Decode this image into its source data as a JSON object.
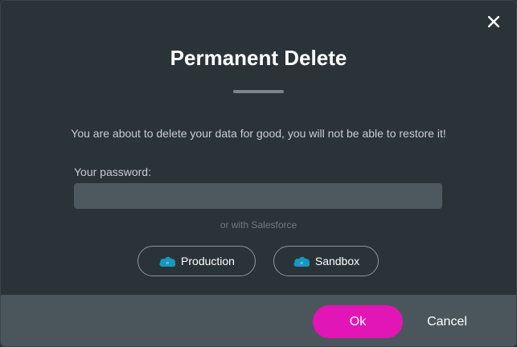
{
  "dialog": {
    "title": "Permanent Delete",
    "warning": "You are about to delete your data for good, you will not be able to restore it!",
    "password_label": "Your password:",
    "password_value": "",
    "password_placeholder": "",
    "or_text": "or with Salesforce",
    "salesforce_buttons": [
      {
        "label": "Production",
        "icon": "salesforce-cloud-icon"
      },
      {
        "label": "Sandbox",
        "icon": "salesforce-cloud-icon"
      }
    ],
    "close_icon": "close-icon"
  },
  "footer": {
    "ok_label": "Ok",
    "cancel_label": "Cancel"
  },
  "colors": {
    "background": "#2a3338",
    "footer": "#4b565c",
    "input": "#4d595f",
    "ok_button": "#e215b6",
    "salesforce_blue": "#1798c1"
  }
}
